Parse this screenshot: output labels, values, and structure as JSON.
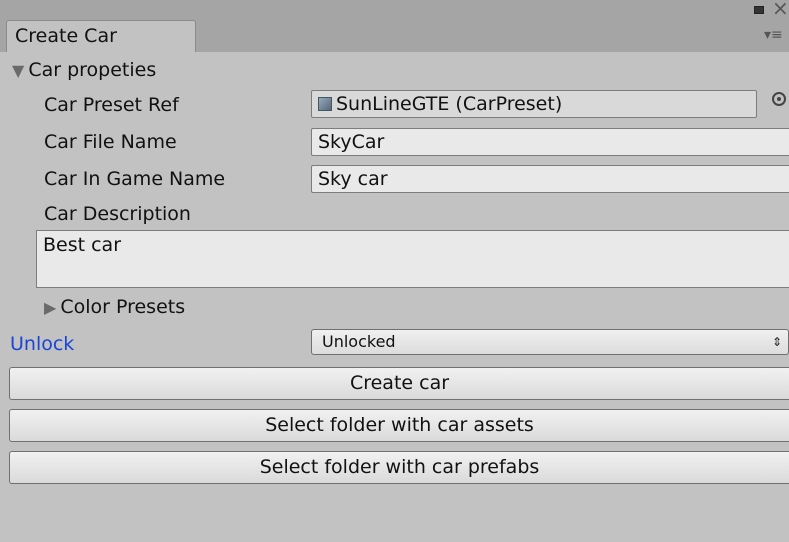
{
  "window": {
    "tab_title": "Create Car",
    "close_glyph": "×",
    "menu_glyph": "▾≡"
  },
  "car_properties": {
    "header": "Car propeties",
    "preset_ref": {
      "label": "Car Preset Ref",
      "value": "SunLineGTE (CarPreset)"
    },
    "file_name": {
      "label": "Car File Name",
      "value": "SkyCar"
    },
    "in_game_name": {
      "label": "Car In Game Name",
      "value": "Sky car"
    },
    "description": {
      "label": "Car Description",
      "value": "Best car"
    },
    "color_presets": {
      "label": "Color Presets"
    }
  },
  "unlock": {
    "label": "Unlock",
    "selected": "Unlocked",
    "label_color": "#1a45d6"
  },
  "buttons": {
    "create": "Create car",
    "select_assets": "Select folder with car assets",
    "select_prefabs": "Select folder with car prefabs"
  },
  "icons": {
    "foldout_open": "▼",
    "foldout_closed": "▶",
    "popup_arrows": "⇕"
  }
}
